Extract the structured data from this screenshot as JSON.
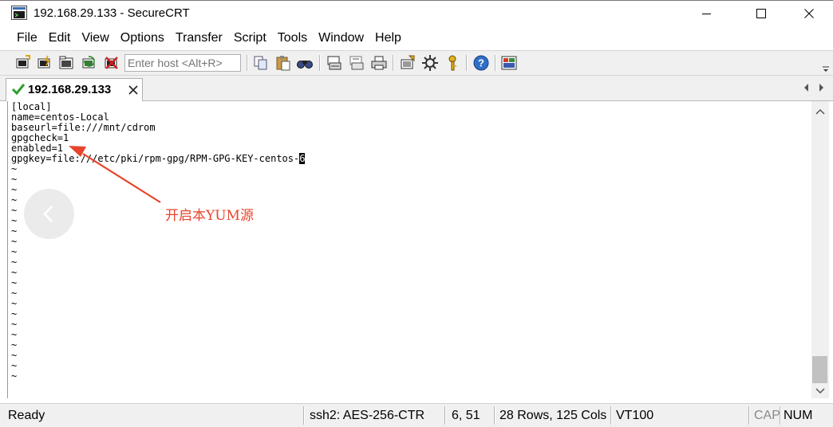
{
  "window": {
    "title": "192.168.29.133 - SecureCRT"
  },
  "menu": [
    "File",
    "Edit",
    "View",
    "Options",
    "Transfer",
    "Script",
    "Tools",
    "Window",
    "Help"
  ],
  "toolbar": {
    "host_placeholder": "Enter host <Alt+R>",
    "buttons": [
      "connect-icon",
      "quick-connect-icon",
      "connect-in-tab-icon",
      "reconnect-icon",
      "disconnect-icon",
      "copy-icon",
      "paste-icon",
      "find-icon",
      "print-screen-icon",
      "print-selection-icon",
      "print-icon",
      "session-options-icon",
      "global-options-icon",
      "keymap-icon",
      "help-icon",
      "screen-icon"
    ]
  },
  "tab": {
    "label": "192.168.29.133",
    "status_color": "#2e9e2e"
  },
  "terminal": {
    "lines": [
      "[local]",
      "name=centos-Local",
      "baseurl=file:///mnt/cdrom",
      "gpgcheck=1",
      "enabled=1",
      "gpgkey=file:///etc/pki/rpm-gpg/RPM-GPG-KEY-centos-"
    ],
    "cursor_char": "6",
    "tilde_lines": [
      "~",
      "~",
      "~",
      "~",
      "~",
      "~",
      "~",
      "~",
      "~",
      "~",
      "~",
      "~",
      "~",
      "~",
      "~",
      "~",
      "~",
      "~",
      "~",
      "~",
      "~"
    ]
  },
  "annotation": {
    "text": "开启本YUM源",
    "color": "#e8442c"
  },
  "status": {
    "state": "Ready",
    "cipher": "ssh2: AES-256-CTR",
    "position": "6,  51",
    "size": "28 Rows, 125 Cols",
    "emulation": "VT100",
    "cap": "CAP",
    "num": "NUM"
  }
}
